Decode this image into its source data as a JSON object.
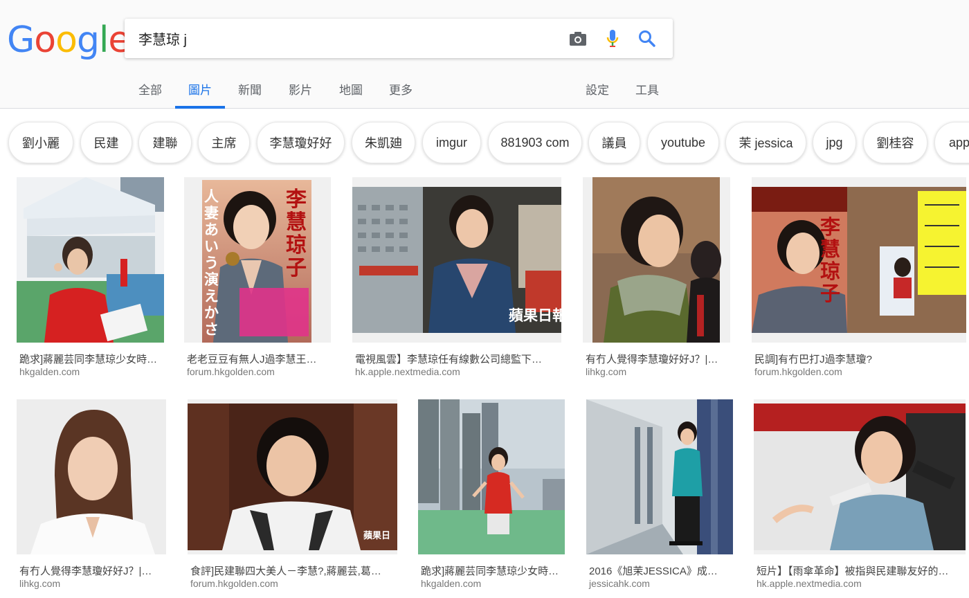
{
  "logo": {
    "letters": [
      "G",
      "o",
      "o",
      "g",
      "l",
      "e"
    ],
    "colors": [
      "#4285f4",
      "#ea4335",
      "#fbbc05",
      "#4285f4",
      "#34a853",
      "#ea4335"
    ]
  },
  "search": {
    "value": "李慧琼 j",
    "icons": [
      "camera-icon",
      "microphone-icon",
      "search-icon"
    ]
  },
  "tabs": [
    {
      "label": "全部",
      "active": false
    },
    {
      "label": "圖片",
      "active": true
    },
    {
      "label": "新聞",
      "active": false
    },
    {
      "label": "影片",
      "active": false
    },
    {
      "label": "地圖",
      "active": false
    },
    {
      "label": "更多",
      "active": false
    },
    {
      "label": "設定",
      "active": false
    },
    {
      "label": "工具",
      "active": false
    }
  ],
  "chips": [
    "劉小麗",
    "民建",
    "建聯",
    "主席",
    "李慧瓊好好",
    "朱凱廸",
    "imgur",
    "881903 com",
    "議員",
    "youtube",
    "茉 jessica",
    "jpg",
    "劉桂容",
    "app"
  ],
  "results": [
    {
      "title": "跪求]蔣麗芸同李慧琼少女時…",
      "source": "hkgalden.com"
    },
    {
      "title": "老老豆豆有無人J過李慧王…",
      "source": "forum.hkgolden.com",
      "overlay_top": "人妻あいう演えかさ",
      "overlay_name": "李慧琼子"
    },
    {
      "title": "電視風雲】李慧琼任有線數公司總監下…",
      "source": "hk.apple.nextmedia.com",
      "overlay": "蘋果日報"
    },
    {
      "title": "有冇人覺得李慧瓊好好J？|…",
      "source": "lihkg.com"
    },
    {
      "title": "民調]有冇巴打J過李慧瓊?",
      "source": "forum.hkgolden.com",
      "overlay_name": "李慧琼子"
    },
    {
      "title": "有冇人覺得李慧瓊好好J？|…",
      "source": "lihkg.com"
    },
    {
      "title": "食評]民建聯四大美人－李慧?,蔣麗芸,葛…",
      "source": "forum.hkgolden.com",
      "overlay": "蘋果日"
    },
    {
      "title": "跪求]蔣麗芸同李慧琼少女時…",
      "source": "hkgalden.com"
    },
    {
      "title": "2016《旭茉JESSICA》成…",
      "source": "jessicahk.com"
    },
    {
      "title": "短片】【雨傘革命】被指與民建聯友好的…",
      "source": "hk.apple.nextmedia.com"
    }
  ],
  "colors": {
    "accent": "#1a73e8"
  }
}
